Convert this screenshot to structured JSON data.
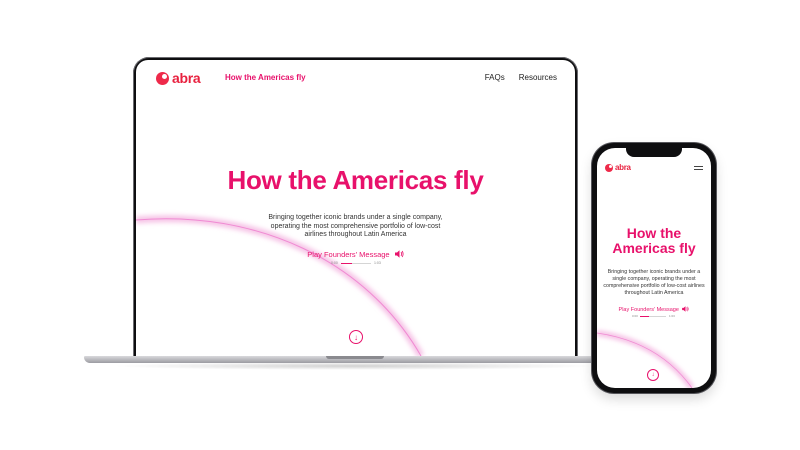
{
  "brand": {
    "name": "abra",
    "accent_color": "#e8116b",
    "logo_color": "#e8213f"
  },
  "laptop": {
    "nav_title": "How the Americas fly",
    "nav_links": [
      "FAQs",
      "Resources"
    ],
    "headline": "How the Americas fly",
    "description": "Bringing together iconic brands under a single company, operating the most comprehensive portfolio of low-cost airlines throughout Latin America",
    "play_label": "Play Founders' Message",
    "player": {
      "current_time": "0:00",
      "duration": "1:03",
      "progress": 0.35
    },
    "icons": {
      "speaker": "speaker-icon",
      "scroll": "arrow-down-circle-icon"
    }
  },
  "phone": {
    "headline": "How the Americas fly",
    "description": "Bringing together iconic brands under a single company, operating the most comprehensive portfolio of low-cost airlines throughout Latin America",
    "play_label": "Play Founders' Message",
    "player": {
      "current_time": "0:00",
      "duration": "1:03",
      "progress": 0.35
    },
    "icons": {
      "menu": "hamburger-menu-icon",
      "speaker": "speaker-icon",
      "scroll": "arrow-down-circle-icon"
    }
  }
}
